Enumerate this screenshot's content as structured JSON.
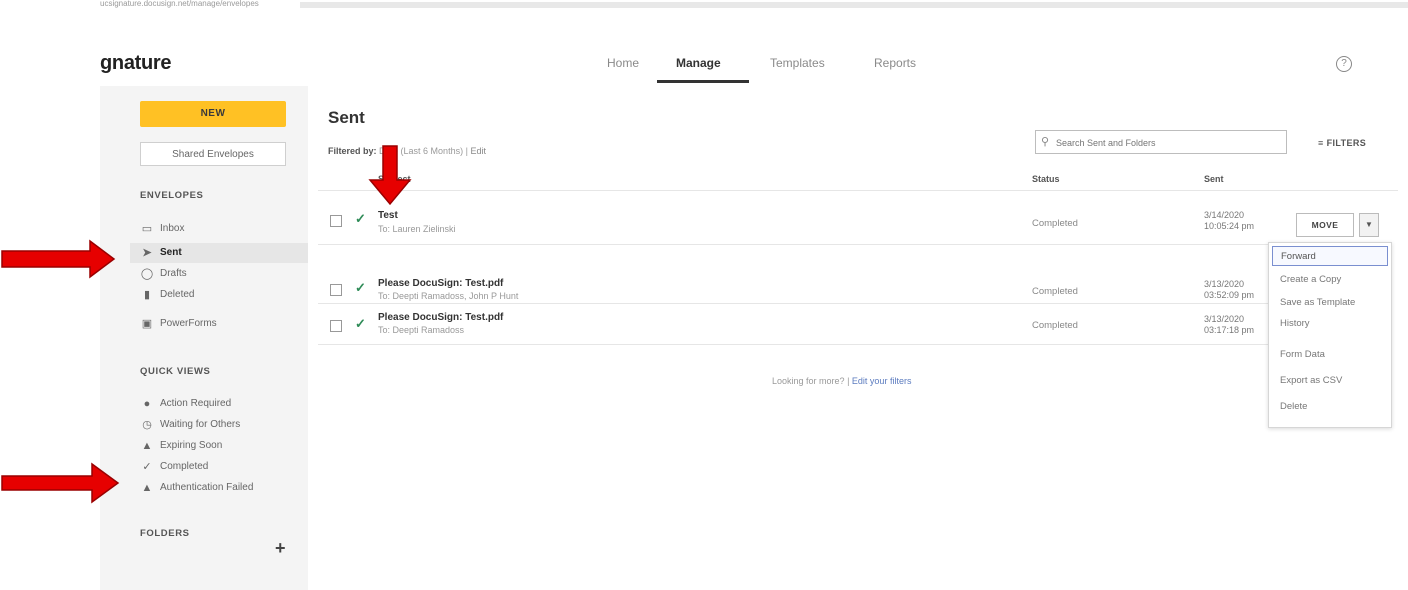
{
  "top": {
    "crumb": "ucsignature.docusign.net/manage/envelopes"
  },
  "header": {
    "brand": "gnature",
    "nav": [
      "Home",
      "Manage",
      "Templates",
      "Reports"
    ],
    "active_nav": "Manage",
    "help_icon": "help-circle-icon"
  },
  "sidebar": {
    "new_label": "NEW",
    "shared_label": "Shared Envelopes",
    "envelopes_head": "ENVELOPES",
    "envelopes": [
      {
        "label": "Inbox",
        "icon": "inbox-icon"
      },
      {
        "label": "Sent",
        "icon": "send-icon"
      },
      {
        "label": "Drafts",
        "icon": "draft-icon"
      },
      {
        "label": "Deleted",
        "icon": "trash-icon"
      },
      {
        "label": "PowerForms",
        "icon": "powerform-icon"
      }
    ],
    "quick_head": "QUICK VIEWS",
    "quick": [
      {
        "label": "Action Required",
        "icon": "alert-icon"
      },
      {
        "label": "Waiting for Others",
        "icon": "clock-icon"
      },
      {
        "label": "Expiring Soon",
        "icon": "warning-icon"
      },
      {
        "label": "Completed",
        "icon": "check-icon"
      },
      {
        "label": "Authentication Failed",
        "icon": "warning-icon"
      }
    ],
    "folders_head": "FOLDERS",
    "add_folder": "+"
  },
  "main": {
    "title": "Sent",
    "filter_prefix": "Filtered by:",
    "filter_value": "Date (Last 6 Months)",
    "filter_sep": "|",
    "filter_edit": "Edit",
    "search_placeholder": "Search Sent and Folders",
    "filters_label": "FILTERS",
    "columns": {
      "subject": "Subject",
      "status": "Status",
      "sent": "Sent"
    },
    "rows": [
      {
        "subject": "Test",
        "to": "To: Lauren Zielinski",
        "status": "Completed",
        "date": "3/14/2020",
        "time": "10:05:24 pm"
      },
      {
        "subject": "Please DocuSign: Test.pdf",
        "to": "To: Deepti Ramadoss, John P Hunt",
        "status": "Completed",
        "date": "3/13/2020",
        "time": "03:52:09 pm"
      },
      {
        "subject": "Please DocuSign: Test.pdf",
        "to": "To: Deepti Ramadoss",
        "status": "Completed",
        "date": "3/13/2020",
        "time": "03:17:18 pm"
      }
    ],
    "move_label": "MOVE",
    "looking_text": "Looking for more?",
    "looking_sep": "|",
    "looking_link": "Edit your filters"
  },
  "menu": {
    "items": [
      "Forward",
      "Create a Copy",
      "Save as Template",
      "History",
      "Form Data",
      "Export as CSV",
      "Delete"
    ],
    "highlighted": "Forward"
  },
  "colors": {
    "accent": "#ffc124",
    "arrow": "#e60000",
    "check": "#2e8b57"
  }
}
